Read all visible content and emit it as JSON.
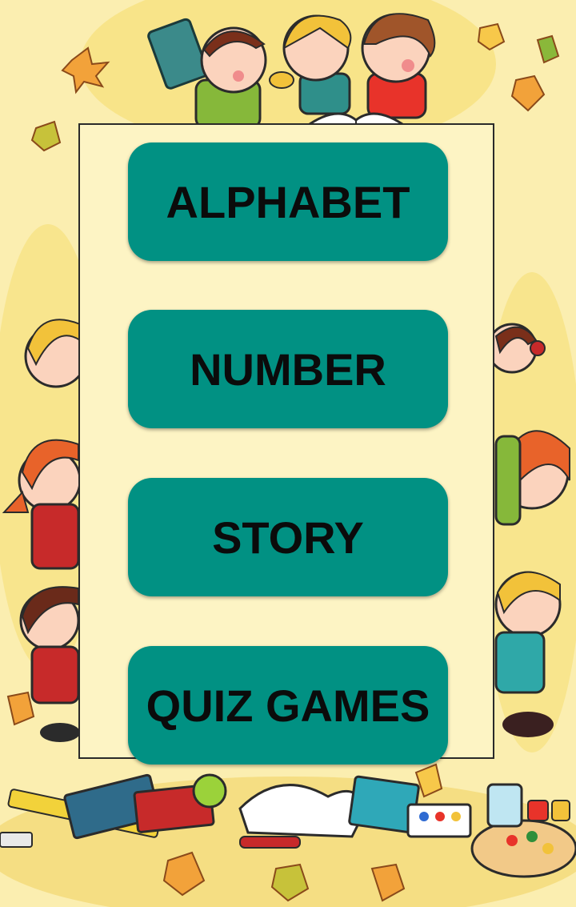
{
  "app": {
    "background_color": "#fbeeb0",
    "board_color": "#fdf4c4",
    "button_color": "#019183",
    "button_text_color": "#0b0b0b"
  },
  "menu": {
    "buttons": [
      {
        "label": "ALPHABET"
      },
      {
        "label": "NUMBER"
      },
      {
        "label": "STORY"
      },
      {
        "label": "QUIZ GAMES"
      }
    ]
  },
  "decorations": {
    "icons": [
      "autumn-leaf-icon",
      "child-cartoon-icon",
      "open-book-icon",
      "school-supplies-icon",
      "paint-palette-icon",
      "apple-icon"
    ]
  }
}
